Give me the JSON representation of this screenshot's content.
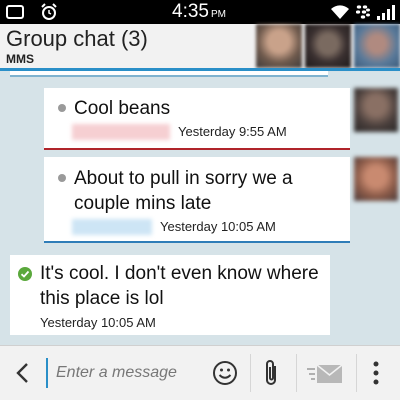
{
  "status_bar": {
    "time": "4:35",
    "ampm": "PM",
    "icons": [
      "notification-icon",
      "alarm-icon",
      "wifi-icon",
      "blackberry-logo-icon",
      "signal-icon"
    ]
  },
  "header": {
    "title": "Group chat (3)",
    "subtitle": "MMS"
  },
  "messages": [
    {
      "text": "Cool beans",
      "time": "Yesterday 9:55 AM",
      "direction": "incoming",
      "sender_color": "#f6cfd2"
    },
    {
      "text_line1": "About to pull in sorry we a",
      "text_line2": "couple mins late",
      "time": "Yesterday 10:05 AM",
      "direction": "incoming",
      "sender_color": "#cde5f5"
    },
    {
      "text_line1": "It's cool. I don't even know where",
      "text_line2": "this place is lol",
      "time": "Yesterday 10:05 AM",
      "direction": "outgoing",
      "status": "delivered"
    }
  ],
  "compose": {
    "placeholder": "Enter a message"
  },
  "colors": {
    "accent": "#2a8fc8",
    "background": "#d6e3e8",
    "red_rule": "#b0242a",
    "check": "#5aa83c"
  }
}
